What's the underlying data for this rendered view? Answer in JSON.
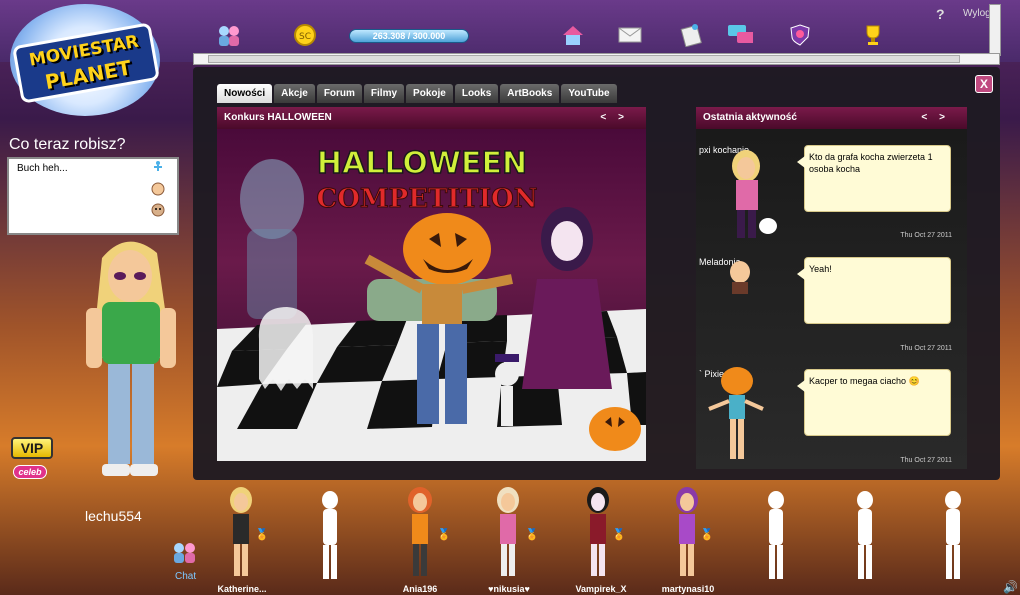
{
  "app": {
    "logo_line1": "MOVIESTAR",
    "logo_line2": "PLANET"
  },
  "topbar": {
    "currency": "263.308 / 300.000",
    "help": "?",
    "logout": "Wylog",
    "icons": [
      "friends-icon",
      "starcoins-icon",
      "home-icon",
      "mail-icon",
      "profile-icon",
      "chat-icon",
      "shield-icon",
      "trophy-icon"
    ]
  },
  "status": {
    "question": "Co teraz robisz?",
    "text": "Buch heh..."
  },
  "player": {
    "username": "lechu554",
    "vip": "VIP",
    "celeb": "celeb"
  },
  "tabs": [
    "Nowości",
    "Akcje",
    "Forum",
    "Filmy",
    "Pokoje",
    "Looks",
    "ArtBooks",
    "YouTube"
  ],
  "active_tab": "Nowości",
  "news": {
    "title": "Konkurs HALLOWEEN",
    "image_line1": "HALLOWEEN",
    "image_line2": "COMPETITION",
    "prev": "<",
    "next": ">"
  },
  "activity": {
    "title": "Ostatnia aktywność",
    "items": [
      {
        "user": "pxi kochanie",
        "text": "Kto da grafa kocha zwierzeta 1 osoba kocha",
        "date": "Thu Oct 27 2011"
      },
      {
        "user": "Meladonia",
        "text": "Yeah!",
        "date": "Thu Oct 27 2011"
      },
      {
        "user": "` Pixie",
        "text": "Kacper to megaa ciacho 😊",
        "date": "Thu Oct 27 2011"
      }
    ]
  },
  "room": {
    "chat_label": "Chat",
    "avatars": [
      "Katherine...",
      "Ania196",
      "♥nikusia♥",
      "Vampirek_X",
      "martynasi10"
    ]
  },
  "colors": {
    "accent": "#7a1a4a",
    "panel": "#1e1a22",
    "bubble": "#fffbd6"
  }
}
